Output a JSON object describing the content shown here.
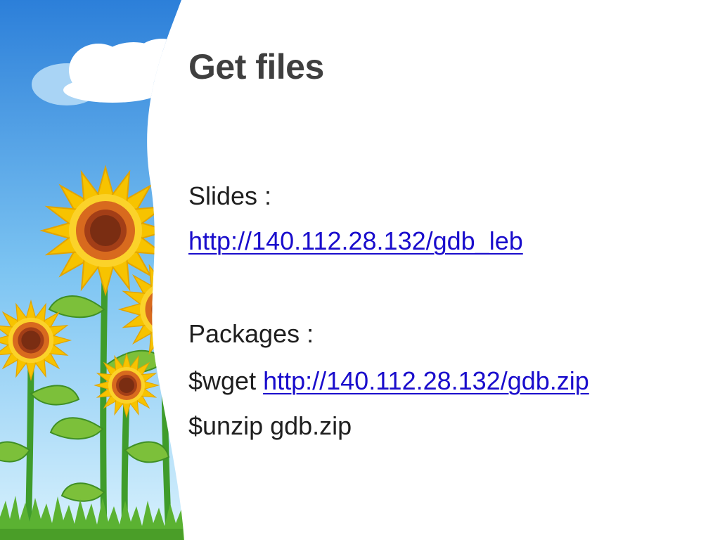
{
  "slide": {
    "title": "Get files",
    "slides_label": "Slides :",
    "slides_link": "http://140.112.28.132/gdb_leb",
    "packages_label": "Packages :",
    "wget_prefix": "$wget ",
    "wget_link": "http://140.112.28.132/gdb.zip",
    "unzip_cmd": "$unzip gdb.zip"
  },
  "decoration": {
    "icons": [
      "sunflower-icon",
      "cloud-icon",
      "grass-icon"
    ],
    "colors": {
      "sky_top": "#2c7fd9",
      "sky_bottom": "#bfe6fb",
      "petal": "#f7c300",
      "center": "#c8531b",
      "stem": "#3f9c2b",
      "leaf": "#7cc03a"
    }
  },
  "colors": {
    "title": "#3f3f3f",
    "text": "#1f1f1f",
    "link": "#1a0dcc"
  }
}
